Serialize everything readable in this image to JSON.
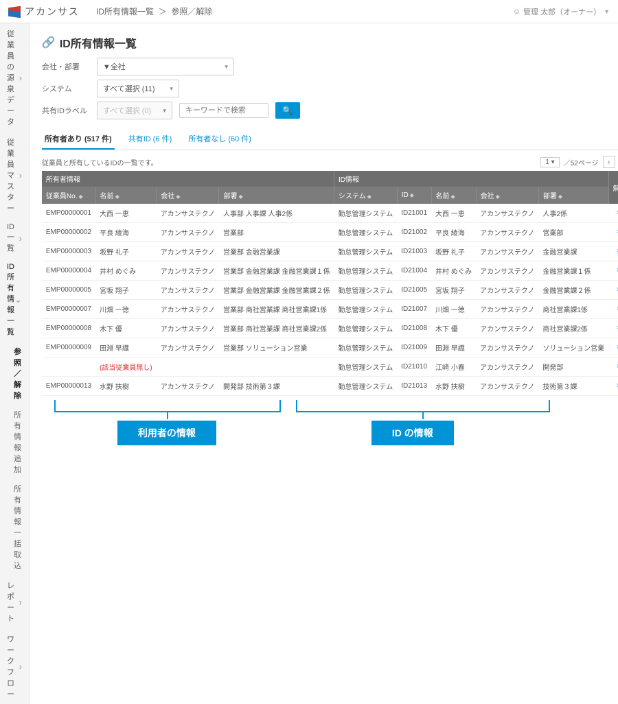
{
  "brand": "アカンサス",
  "breadcrumb": {
    "a": "ID所有情報一覧",
    "sep": "＞",
    "b": "参照／解除"
  },
  "user": {
    "name": "管理 太郎（オーナー）"
  },
  "sidebar": {
    "items": [
      {
        "label": "従業員の源泉データ"
      },
      {
        "label": "従業員マスター"
      },
      {
        "label": "ID一覧"
      },
      {
        "label": "ID所有情報一覧",
        "open": true,
        "subs": [
          {
            "label": "参照／解除",
            "active": true
          },
          {
            "label": "所有情報追加"
          },
          {
            "label": "所有情報一括取込"
          }
        ]
      },
      {
        "label": "レポート"
      },
      {
        "label": "ワークフロー"
      }
    ]
  },
  "page": {
    "title": "ID所有情報一覧"
  },
  "filters": {
    "org_label": "会社・部署",
    "org_value": "▼全社",
    "sys_label": "システム",
    "sys_value": "すべて選択 (11)",
    "shared_label": "共有IDラベル",
    "shared_placeholder": "すべて選択 (0)",
    "keyword_placeholder": "キーワードで検索"
  },
  "tabs": [
    {
      "label": "所有者あり (517 件)",
      "active": true
    },
    {
      "label": "共有ID (6 件)"
    },
    {
      "label": "所有者なし (60 件)"
    }
  ],
  "note": "従業員と所有しているIDの一覧です。",
  "pager": {
    "size": "1",
    "total": "／52ページ"
  },
  "grid": {
    "group_owner": "所有者情報",
    "group_id": "ID情報",
    "col_del": "解除",
    "cols_owner": [
      "従業員No.",
      "名前",
      "会社",
      "部署"
    ],
    "cols_id": [
      "システム",
      "ID",
      "名前",
      "会社",
      "部署"
    ],
    "no_owner": "(該当従業員無し)",
    "rows": [
      {
        "eno": "EMP00000001",
        "ename": "大西 一恵",
        "ecomp": "アカンサステクノ",
        "edept": "人事部 人事課 人事2係",
        "sys": "勤怠管理システム",
        "id": "ID21001",
        "iname": "大西 一恵",
        "icomp": "アカンサステクノ",
        "idept": "人事2係"
      },
      {
        "eno": "EMP00000002",
        "ename": "平良 綾海",
        "ecomp": "アカンサステクノ",
        "edept": "営業部",
        "sys": "勤怠管理システム",
        "id": "ID21002",
        "iname": "平良 綾海",
        "icomp": "アカンサステクノ",
        "idept": "営業部"
      },
      {
        "eno": "EMP00000003",
        "ename": "坂野 礼子",
        "ecomp": "アカンサステクノ",
        "edept": "営業部 金融営業課",
        "sys": "勤怠管理システム",
        "id": "ID21003",
        "iname": "坂野 礼子",
        "icomp": "アカンサステクノ",
        "idept": "金融営業課"
      },
      {
        "eno": "EMP00000004",
        "ename": "井村 めぐみ",
        "ecomp": "アカンサステクノ",
        "edept": "営業部 金融営業課 金融営業課１係",
        "sys": "勤怠管理システム",
        "id": "ID21004",
        "iname": "井村 めぐみ",
        "icomp": "アカンサステクノ",
        "idept": "金融営業課１係"
      },
      {
        "eno": "EMP00000005",
        "ename": "宮坂 翔子",
        "ecomp": "アカンサステクノ",
        "edept": "営業部 金融営業課 金融営業課２係",
        "sys": "勤怠管理システム",
        "id": "ID21005",
        "iname": "宮坂 翔子",
        "icomp": "アカンサステクノ",
        "idept": "金融営業課２係"
      },
      {
        "eno": "EMP00000007",
        "ename": "川畑 一徳",
        "ecomp": "アカンサステクノ",
        "edept": "営業部 商社営業課 商社営業課1係",
        "sys": "勤怠管理システム",
        "id": "ID21007",
        "iname": "川畑 一徳",
        "icomp": "アカンサステクノ",
        "idept": "商社営業課1係"
      },
      {
        "eno": "EMP00000008",
        "ename": "木下 優",
        "ecomp": "アカンサステクノ",
        "edept": "営業部 商社営業課 商社営業課2係",
        "sys": "勤怠管理システム",
        "id": "ID21008",
        "iname": "木下 優",
        "icomp": "アカンサステクノ",
        "idept": "商社営業課2係"
      },
      {
        "eno": "EMP00000009",
        "ename": "田淵 早織",
        "ecomp": "アカンサステクノ",
        "edept": "営業部 ソリューション営業",
        "sys": "勤怠管理システム",
        "id": "ID21009",
        "iname": "田淵 早織",
        "icomp": "アカンサステクノ",
        "idept": "ソリューション営業"
      },
      {
        "nouser": true,
        "sys": "勤怠管理システム",
        "id": "ID21010",
        "iname": "江崎 小春",
        "icomp": "アカンサステクノ",
        "idept": "開発部"
      },
      {
        "eno": "EMP00000013",
        "ename": "水野 扶樹",
        "ecomp": "アカンサステクノ",
        "edept": "開発部 技術第３課",
        "sys": "勤怠管理システム",
        "id": "ID21013",
        "iname": "水野 扶樹",
        "icomp": "アカンサステクノ",
        "idept": "技術第３課"
      }
    ]
  },
  "annot": {
    "left": "利用者の情報",
    "right": "ID の情報"
  }
}
